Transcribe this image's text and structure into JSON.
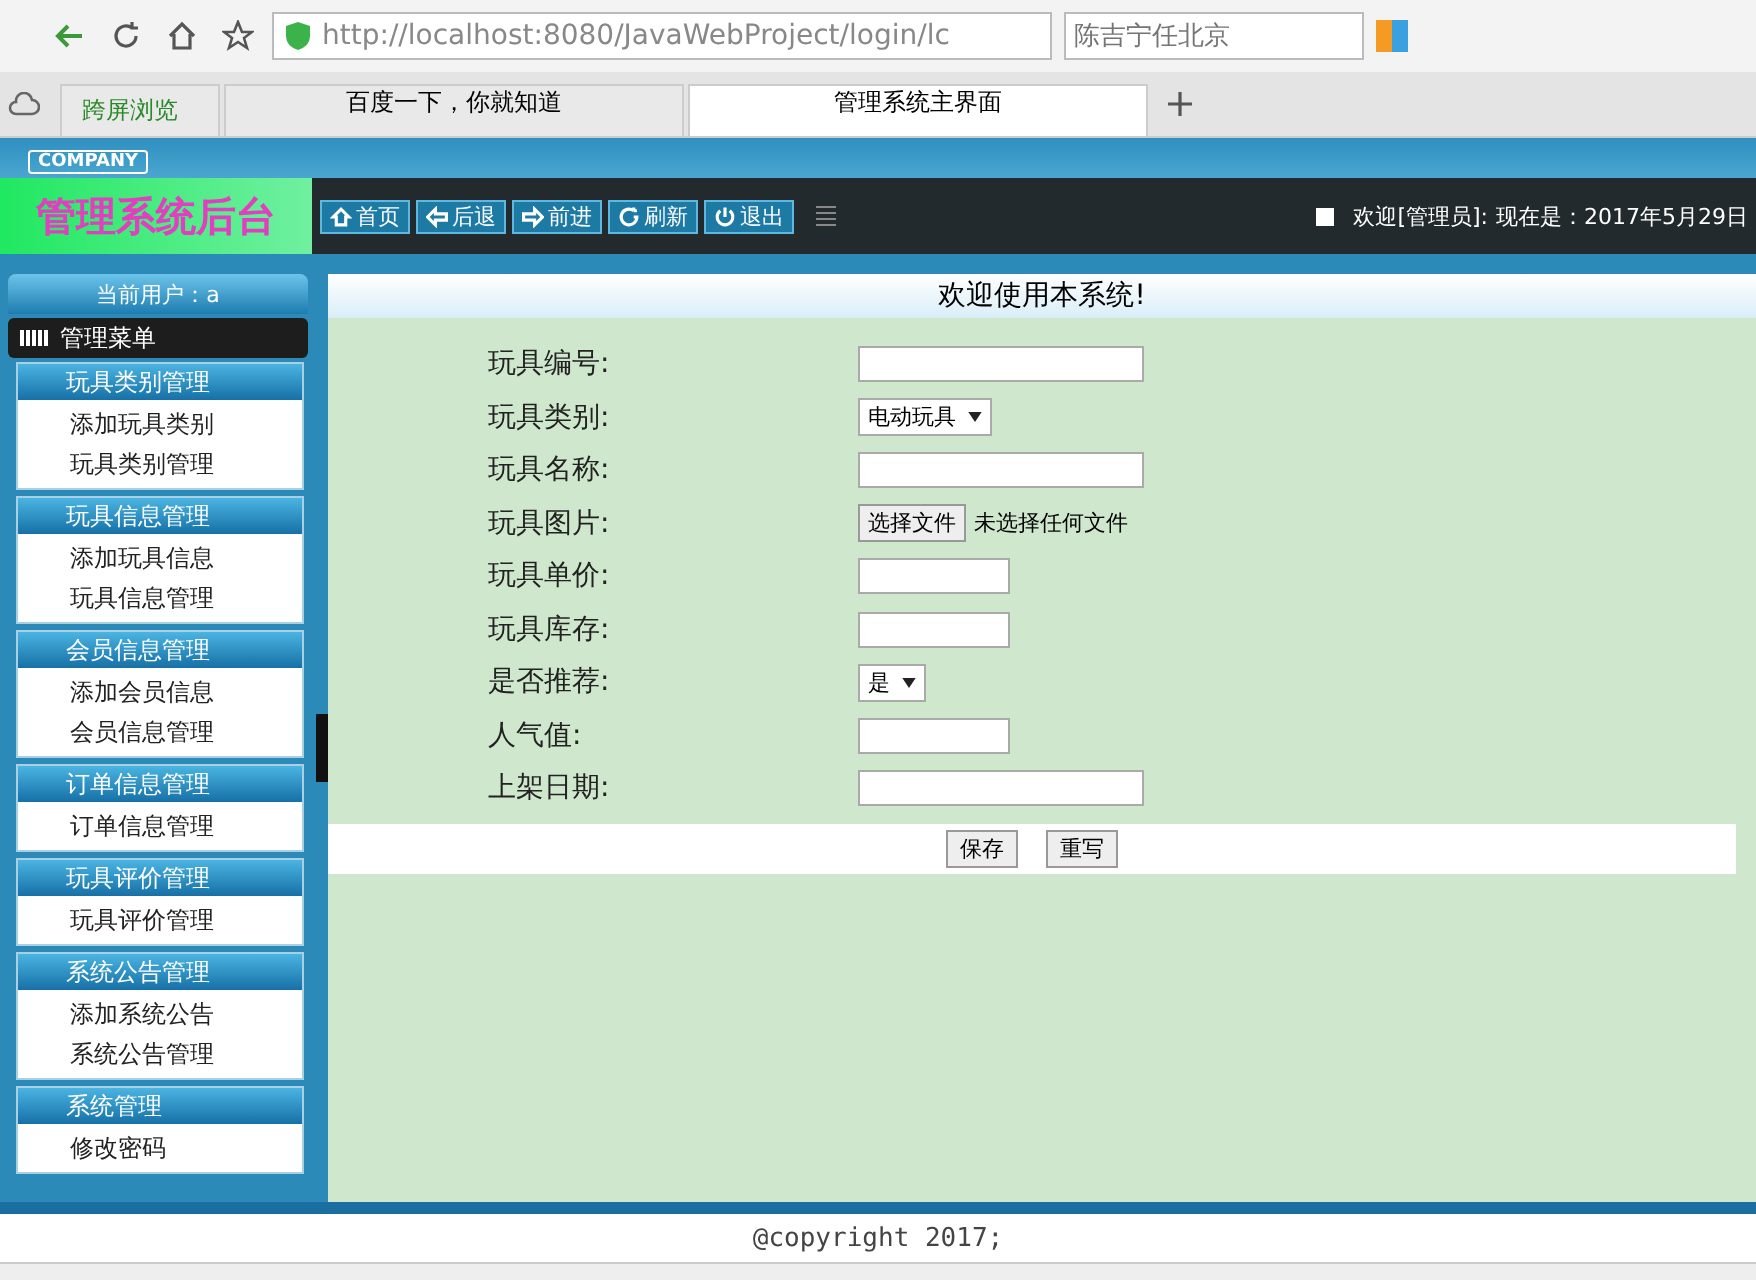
{
  "browser": {
    "address_url": "http://localhost:8080/JavaWebProject/login/lc",
    "search_placeholder": "陈吉宁任北京",
    "tabs": [
      {
        "label": "跨屏浏览",
        "kind": "pinned",
        "selected": false
      },
      {
        "label": "百度一下，你就知道",
        "kind": "page",
        "selected": false
      },
      {
        "label": "管理系统主界面",
        "kind": "page",
        "selected": true
      }
    ]
  },
  "header": {
    "company": "COMPANY",
    "title": "管理系统后台",
    "nav": [
      {
        "label": "首页",
        "kind": "home"
      },
      {
        "label": "后退",
        "kind": "back"
      },
      {
        "label": "前进",
        "kind": "forward"
      },
      {
        "label": "刷新",
        "kind": "refresh"
      },
      {
        "label": "退出",
        "kind": "power"
      }
    ],
    "welcome": "欢迎[管理员]:",
    "date": "现在是：2017年5月29日"
  },
  "sidebar": {
    "current_user": "当前用户：a",
    "menu_title": "管理菜单",
    "groups": [
      {
        "title": "玩具类别管理",
        "items": [
          "添加玩具类别",
          "玩具类别管理"
        ]
      },
      {
        "title": "玩具信息管理",
        "items": [
          "添加玩具信息",
          "玩具信息管理"
        ]
      },
      {
        "title": "会员信息管理",
        "items": [
          "添加会员信息",
          "会员信息管理"
        ]
      },
      {
        "title": "订单信息管理",
        "items": [
          "订单信息管理"
        ]
      },
      {
        "title": "玩具评价管理",
        "items": [
          "玩具评价管理"
        ]
      },
      {
        "title": "系统公告管理",
        "items": [
          "添加系统公告",
          "系统公告管理"
        ]
      },
      {
        "title": "系统管理",
        "items": [
          "修改密码"
        ]
      }
    ]
  },
  "main": {
    "title": "欢迎使用本系统!",
    "fields": [
      {
        "label": "玩具编号:",
        "kind": "text"
      },
      {
        "label": "玩具类别:",
        "kind": "select",
        "value": "电动玩具"
      },
      {
        "label": "玩具名称:",
        "kind": "text"
      },
      {
        "label": "玩具图片:",
        "kind": "file",
        "button": "选择文件",
        "status": "未选择任何文件"
      },
      {
        "label": "玩具单价:",
        "kind": "number"
      },
      {
        "label": "玩具库存:",
        "kind": "number"
      },
      {
        "label": "是否推荐:",
        "kind": "select",
        "value": "是"
      },
      {
        "label": "人气值:",
        "kind": "number"
      },
      {
        "label": "上架日期:",
        "kind": "date"
      }
    ],
    "buttons": [
      "保存",
      "重写"
    ]
  },
  "footer": {
    "copyright": "@copyright 2017;"
  }
}
